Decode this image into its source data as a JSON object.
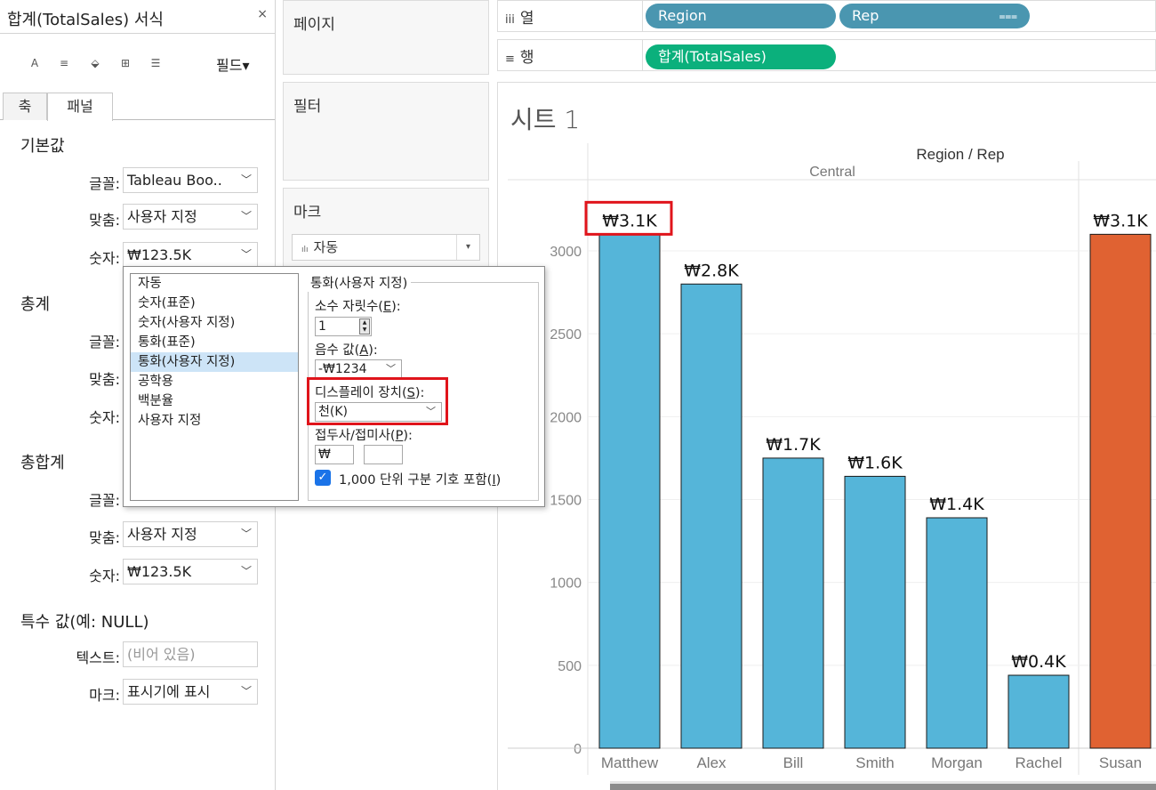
{
  "format_pane": {
    "title": "합계(TotalSales) 서식",
    "close": "×",
    "toolbar": {
      "font_icon": "A",
      "align_icon": "≡",
      "shading_icon": "⬙",
      "borders_icon": "⊞",
      "lines_icon": "☰",
      "fields_label": "필드▾"
    },
    "tabs": [
      "축",
      "패널"
    ],
    "sections": {
      "default": "기본값",
      "totals": "총계",
      "grand_totals": "총합계",
      "special": "특수 값(예: NULL)"
    },
    "labels": {
      "font": "글꼴:",
      "align": "맞춤:",
      "number": "숫자:",
      "text": "텍스트:",
      "marks": "마크:"
    },
    "values": {
      "font": "Tableau Boo..",
      "align": "사용자 지정",
      "number": "₩123.5K",
      "grand_align": "사용자 지정",
      "grand_number": "₩123.5K",
      "text_placeholder": "(비어 있음)",
      "marks": "표시기에 표시"
    }
  },
  "shelves": {
    "pages": "페이지",
    "filters": "필터",
    "marks": "마크",
    "mark_type": "자동",
    "mark_type_icon": "ılı",
    "columns_label": "열",
    "columns_icon": "iii",
    "rows_label": "행",
    "rows_icon": "≡",
    "columns_pills": [
      "Region",
      "Rep"
    ],
    "rows_pills": [
      "합계(TotalSales)"
    ],
    "colors": {
      "dimension": "#4a96b0",
      "measure": "#0bb07c"
    }
  },
  "number_format": {
    "list": [
      "자동",
      "숫자(표준)",
      "숫자(사용자 지정)",
      "통화(표준)",
      "통화(사용자 지정)",
      "공학용",
      "백분율",
      "사용자 지정"
    ],
    "selected_index": 4,
    "group_title": "통화(사용자 지정)",
    "decimals_label": "소수 자릿수(",
    "decimals_key": "E",
    "decimals_value": "1",
    "negative_label": "음수 값(",
    "negative_key": "A",
    "negative_value": "-₩1234",
    "display_label": "디스플레이 장치(",
    "display_key": "S",
    "display_value": "천(K)",
    "prefix_label": "접두사/접미사(",
    "prefix_key": "P",
    "prefix_value": "₩",
    "suffix_value": "",
    "separator_label": "1,000 단위 구분 기호 포함(",
    "separator_key": "I",
    "separator_checked": true
  },
  "sheet": {
    "title": "시트 1"
  },
  "chart_data": {
    "type": "bar",
    "header_title": "Region / Rep",
    "regions": [
      "Central"
    ],
    "categories": [
      "Matthew",
      "Alex",
      "Bill",
      "Smith",
      "Morgan",
      "Rachel",
      "Susan"
    ],
    "category_region": [
      "Central",
      "Central",
      "Central",
      "Central",
      "Central",
      "Central",
      ""
    ],
    "values": [
      3100,
      2800,
      1750,
      1640,
      1390,
      440,
      3100
    ],
    "labels": [
      "₩3.1K",
      "₩2.8K",
      "₩1.7K",
      "₩1.6K",
      "₩1.4K",
      "₩0.4K",
      "₩3.1K"
    ],
    "bar_colors": [
      "#55b5d9",
      "#55b5d9",
      "#55b5d9",
      "#55b5d9",
      "#55b5d9",
      "#55b5d9",
      "#e06232"
    ],
    "ylim": [
      0,
      3000
    ],
    "yticks": [
      0,
      500,
      1000,
      1500,
      2000,
      2500,
      3000
    ],
    "grid": true,
    "highlighted_label_index": 0
  },
  "highlight_color": "#e0141b"
}
